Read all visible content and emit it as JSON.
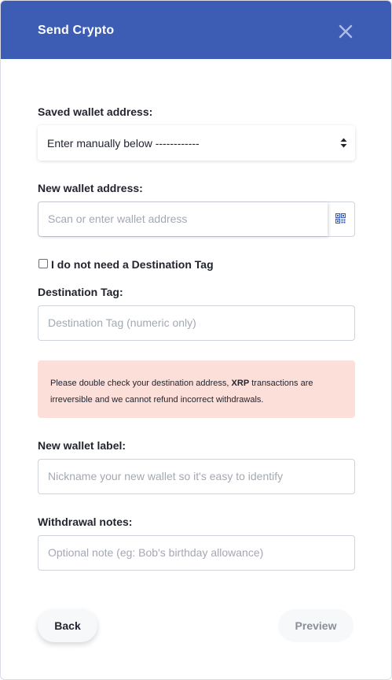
{
  "modal": {
    "title": "Send Crypto",
    "close_icon": "close-icon"
  },
  "saved_wallet": {
    "label": "Saved wallet address:",
    "selected_value": "Enter manually below ------------"
  },
  "new_wallet": {
    "label": "New wallet address:",
    "placeholder": "Scan or enter wallet address",
    "scan_icon": "qr-code-icon"
  },
  "destination_tag_checkbox": {
    "label": "I do not need a Destination Tag",
    "checked": false
  },
  "destination_tag": {
    "label": "Destination Tag:",
    "placeholder": "Destination Tag (numeric only)"
  },
  "alert": {
    "text_before": "Please double check your destination address, ",
    "currency": "XRP",
    "text_after": " transactions are irreversible and we cannot refund incorrect withdrawals."
  },
  "wallet_label": {
    "label": "New wallet label:",
    "placeholder": "Nickname your new wallet so it's easy to identify"
  },
  "withdrawal_notes": {
    "label": "Withdrawal notes:",
    "placeholder": "Optional note (eg: Bob's birthday allowance)"
  },
  "actions": {
    "back_label": "Back",
    "preview_label": "Preview"
  },
  "colors": {
    "header": "#3d5db4",
    "alert_background": "#fddfd9",
    "accent": "#3d5db4"
  }
}
